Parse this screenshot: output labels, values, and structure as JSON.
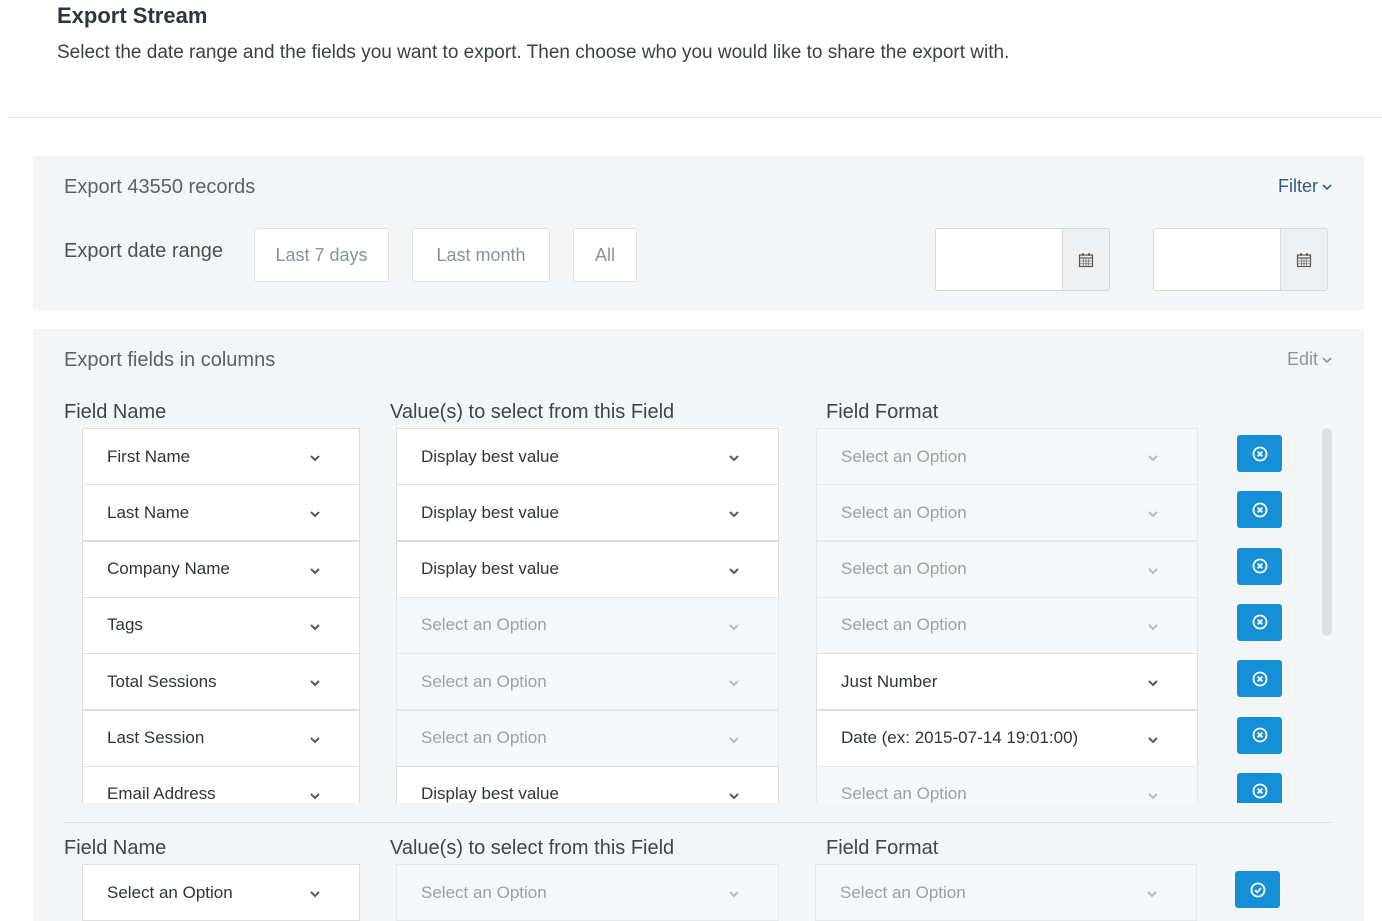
{
  "header": {
    "title": "Export Stream",
    "subtitle": "Select the date range and the fields you want to export. Then choose who you would like to share the export with."
  },
  "range_panel": {
    "title": "Export 43550 records",
    "filter_label": "Filter",
    "range_label": "Export date range",
    "buttons": [
      "Last 7 days",
      "Last month",
      "All"
    ],
    "start_date": "",
    "end_date": ""
  },
  "fields_panel": {
    "title": "Export fields in columns",
    "edit_label": "Edit",
    "headers": {
      "field_name": "Field Name",
      "values": "Value(s) to select from this Field",
      "format": "Field Format"
    },
    "rows": [
      {
        "field": "First Name",
        "value": "Display best value",
        "value_disabled": false,
        "format": "Select an Option",
        "format_disabled": true
      },
      {
        "field": "Last Name",
        "value": "Display best value",
        "value_disabled": false,
        "format": "Select an Option",
        "format_disabled": true
      },
      {
        "field": "Company Name",
        "value": "Display best value",
        "value_disabled": false,
        "format": "Select an Option",
        "format_disabled": true
      },
      {
        "field": "Tags",
        "value": "Select an Option",
        "value_disabled": true,
        "format": "Select an Option",
        "format_disabled": true
      },
      {
        "field": "Total Sessions",
        "value": "Select an Option",
        "value_disabled": true,
        "format": "Just Number",
        "format_disabled": false
      },
      {
        "field": "Last Session",
        "value": "Select an Option",
        "value_disabled": true,
        "format": "Date (ex: 2015-07-14 19:01:00)",
        "format_disabled": false
      },
      {
        "field": "Email Address",
        "value": "Display best value",
        "value_disabled": false,
        "format": "Select an Option",
        "format_disabled": true
      }
    ],
    "new_row": {
      "headers": {
        "field_name": "Field Name",
        "values": "Value(s) to select from this Field",
        "format": "Field Format"
      },
      "field": "Select an Option",
      "value": "Select an Option",
      "format": "Select an Option"
    }
  },
  "colors": {
    "accent": "#1590d6",
    "link": "#2a5d8f",
    "panel_bg": "#f4f5f6"
  },
  "icons": {
    "calendar": "calendar-icon",
    "remove": "remove-circle-icon",
    "add": "check-circle-icon",
    "chevron": "chevron-down-icon"
  }
}
